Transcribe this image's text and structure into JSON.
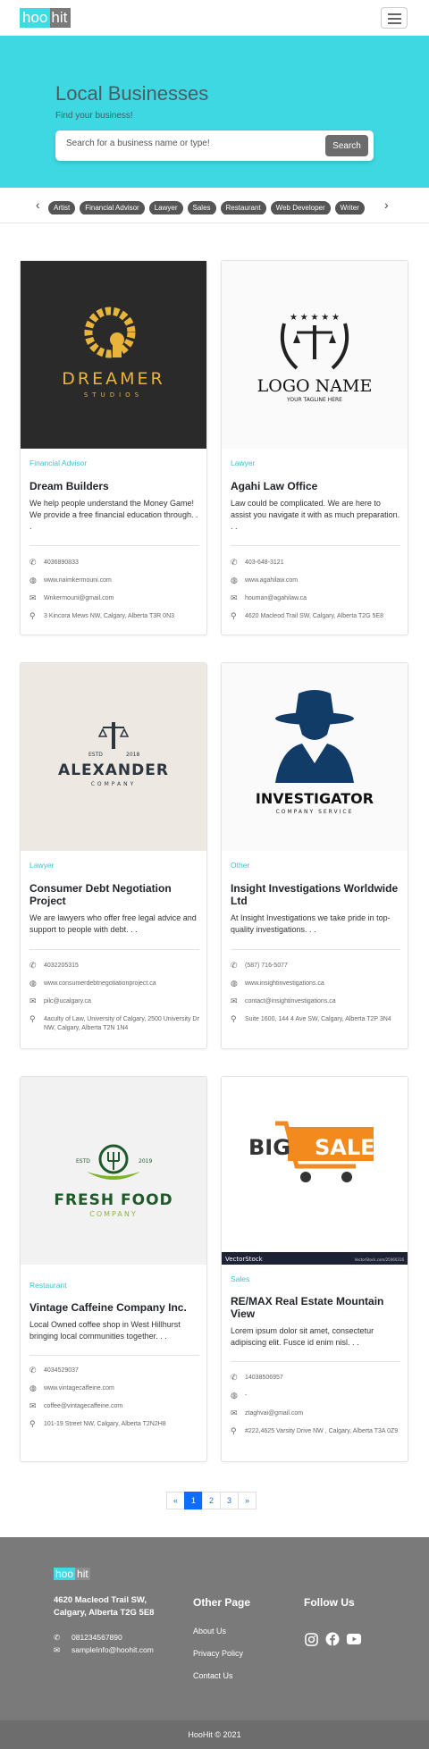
{
  "brand": {
    "part1": "hoo",
    "part2": "hit"
  },
  "hero": {
    "title": "Local Businesses",
    "subtitle": "Find your business!",
    "search_placeholder": "Search for a business name or type!",
    "search_button": "Search"
  },
  "categories": [
    "Artist",
    "Financial Advisor",
    "Lawyer",
    "Sales",
    "Restaurant",
    "Web Developer",
    "Writer"
  ],
  "cards": [
    {
      "category": "Financial Advisor",
      "name": "Dream Builders",
      "desc": "We help people understand the Money Game! We provide a free financial education through. . .",
      "phone": "4036890833",
      "website": "www.naimkermouni.com",
      "email": "Wnkermouni@gmail.com",
      "address": "3 Kincora Mews NW, Calgary, Alberta T3R 0N3",
      "logo": {
        "line1": "DREAMER",
        "line2": "STUDIOS"
      }
    },
    {
      "category": "Lawyer",
      "name": "Agahi Law Office",
      "desc": "Law could be complicated. We are here to assist you navigate it with as much preparation. . .",
      "phone": "403-648-3121",
      "website": "www.agahilaw.com",
      "email": "houman@agahilaw.ca",
      "address": "4620 Macleod Trail SW, Calgary, Alberta T2G 5E8",
      "logo": {
        "line1": "LOGO NAME",
        "line2": "YOUR TAGLINE HERE"
      }
    },
    {
      "category": "Lawyer",
      "name": "Consumer Debt Negotiation Project",
      "desc": "We are lawyers who offer free legal advice and support to people with debt. . .",
      "phone": "4032205315",
      "website": "www.consumerdebtnegotiationproject.ca",
      "email": "pilc@ucalgary.ca",
      "address": "4aculty of Law, University of Calgary, 2500 University Dr NW, Calgary, Alberta T2N 1N4",
      "logo": {
        "line0a": "ESTD",
        "line0b": "2018",
        "line1": "ALEXANDER",
        "line2": "COMPANY"
      }
    },
    {
      "category": "Other",
      "name": "Insight Investigations Worldwide Ltd",
      "desc": "At Insight Investigations we take pride in top-quality investigations. . .",
      "phone": "(587) 716-5077",
      "website": "www.insightinvestigations.ca",
      "email": "contact@insightinvestigations.ca",
      "address": "Suite 1600, 144 4 Ave SW, Calgary, Alberta T2P 3N4",
      "logo": {
        "line1": "INVESTIGATOR",
        "line2": "COMPANY SERVICE"
      }
    },
    {
      "category": "Restaurant",
      "name": "Vintage Caffeine Company Inc.",
      "desc": "Local Owned coffee shop in West Hillhurst bringing local communities together. . .",
      "phone": "4034529037",
      "website": "www.vintagecaffeine.com",
      "email": "coffee@vintagecaffeine.com",
      "address": "101-19 Street NW, Calgary, Alberta T2N2H8",
      "logo": {
        "line0a": "ESTD",
        "line0b": "2019",
        "line1": "FRESH FOOD",
        "line2": "COMPANY"
      }
    },
    {
      "category": "Sales",
      "name": "RE/MAX Real Estate Mountain View",
      "desc": "Lorem ipsum dolor sit amet, consectetur adipiscing elit. Fusce id enim nisl. . .",
      "phone": "14038506957",
      "website": "-",
      "email": "ztaghvai@gmail.com",
      "address": "#222,4625 Varsity Drive NW , Calgary, Alberta T3A 0Z9",
      "logo": {
        "line1": "BIG",
        "line2": "SALE",
        "footer_left": "VectorStock",
        "footer_right": "VectorStock.com/25060316"
      }
    }
  ],
  "pagination": [
    "«",
    "1",
    "2",
    "3",
    "»"
  ],
  "footer": {
    "address_line1": "4620 Macleod Trail SW,",
    "address_line2": "Calgary, Alberta T2G 5E8",
    "phone": "081234567890",
    "email": "sampleInfo@hoohit.com",
    "other_page_title": "Other Page",
    "links": [
      "About Us",
      "Privacy Policy",
      "Contact Us"
    ],
    "follow_title": "Follow Us",
    "copyright": "HooHit © 2021"
  },
  "colors": {
    "accent": "#3dd8e2",
    "category_text": "#3dc3cc",
    "chip": "#555555",
    "footer": "#7a7a7a"
  }
}
